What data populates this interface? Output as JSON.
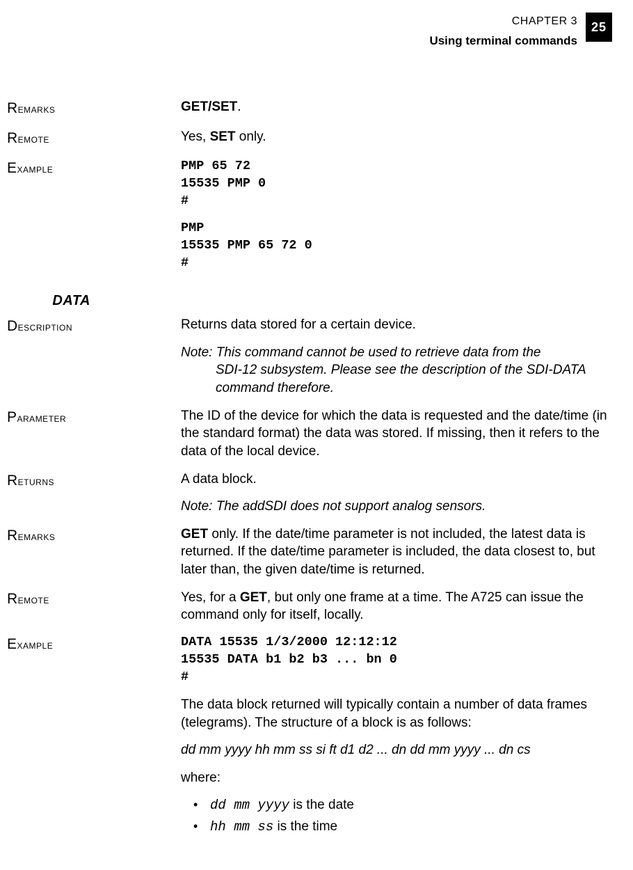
{
  "header": {
    "chapter": "CHAPTER 3",
    "subtitle": "Using terminal commands",
    "page_number": "25"
  },
  "top": {
    "remarks_label": "Remarks",
    "remarks_value_prefix": "GET/SET",
    "remarks_value_suffix": ".",
    "remote_label": "Remote",
    "remote_value_prefix": "Yes, ",
    "remote_value_bold": "SET",
    "remote_value_suffix": " only.",
    "example_label": "Example",
    "example_block1": "PMP 65 72\n15535 PMP 0\n#",
    "example_block2": "PMP\n15535 PMP 65 72 0\n#"
  },
  "section_heading": "DATA",
  "data": {
    "description_label": "Description",
    "description_text": "Returns data stored for a certain device.",
    "description_note_lead": "Note: ",
    "description_note_first": "This command cannot be used to retrieve data from the",
    "description_note_rest": "SDI-12 subsystem. Please see the description of the SDI-DATA command therefore.",
    "parameter_label": "Parameter",
    "parameter_text": "The ID of the device for which the data is requested and the date/time (in the standard format) the data was stored. If missing, then it refers to the data of the local device.",
    "returns_label": "Returns",
    "returns_text": "A data block.",
    "returns_note": "Note: The addSDI does not support analog sensors.",
    "remarks_label": "Remarks",
    "remarks_bold": "GET",
    "remarks_text": " only. If the date/time parameter is not included, the latest data is returned. If the date/time parameter is included, the data closest to, but later than, the given date/time is returned.",
    "remote_label": "Remote",
    "remote_prefix": "Yes, for a ",
    "remote_bold": "GET",
    "remote_suffix": ", but only one frame at a time. The A725 can issue the command only for itself, locally.",
    "example_label": "Example",
    "example_block": "DATA 15535 1/3/2000 12:12:12\n15535 DATA b1 b2 b3 ... bn 0\n#",
    "example_explain": "The data block returned will typically contain a number of data frames (telegrams). The structure of a block is as follows:",
    "example_format": "dd mm yyyy hh mm ss si ft d1 d2 ... dn dd mm yyyy ... dn cs",
    "example_where": "where:",
    "bullets": [
      {
        "code": "dd mm yyyy",
        "text": " is the date"
      },
      {
        "code": "hh mm ss",
        "text": " is the time"
      }
    ]
  }
}
